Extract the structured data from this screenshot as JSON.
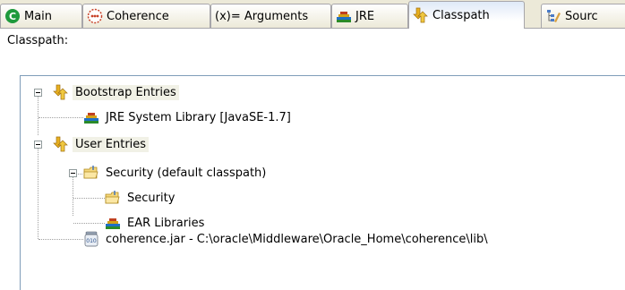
{
  "tabs": [
    {
      "label": "Main",
      "icon": "main-tab-icon"
    },
    {
      "label": "Coherence",
      "icon": "coherence-icon"
    },
    {
      "label": "(x)= Arguments",
      "icon": "arguments-icon"
    },
    {
      "label": "JRE",
      "icon": "library-books-icon"
    },
    {
      "label": "Classpath",
      "icon": "classpath-arrows-icon",
      "active": true
    },
    {
      "label": "Sourc",
      "icon": "source-icon"
    }
  ],
  "classpath_label": "Classpath:",
  "tree": {
    "bootstrap": "Bootstrap Entries",
    "jre_library": "JRE System Library [JavaSE-1.7]",
    "user_entries": "User Entries",
    "security_default": "Security (default classpath)",
    "security": "Security",
    "ear_libraries": "EAR Libraries",
    "coherence_jar": "coherence.jar - C:\\oracle\\Middleware\\Oracle_Home\\coherence\\lib\\"
  },
  "colors": {
    "tab_bg": "#ece9d8",
    "active_tab": "#ffffff",
    "selection": "#f1f1e6",
    "tree_border": "#7f9db9"
  }
}
